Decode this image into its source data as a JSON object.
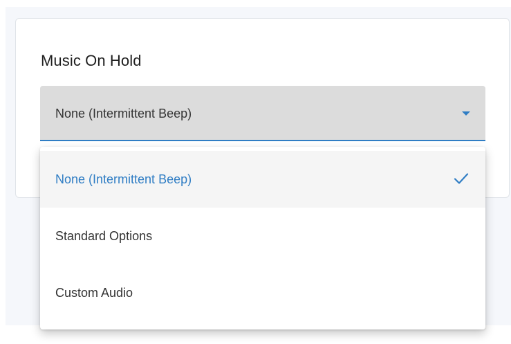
{
  "music_on_hold": {
    "title": "Music On Hold",
    "selected_value": "None (Intermittent Beep)",
    "options": [
      {
        "label": "None (Intermittent Beep)",
        "selected": true
      },
      {
        "label": "Standard Options",
        "selected": false
      },
      {
        "label": "Custom Audio",
        "selected": false
      }
    ]
  },
  "icons": {
    "dropdown": "caret-down-icon",
    "selected": "check-icon"
  },
  "colors": {
    "accent": "#2f7dc4",
    "field_background": "#dcdcdc",
    "selected_row": "#f5f5f5"
  }
}
